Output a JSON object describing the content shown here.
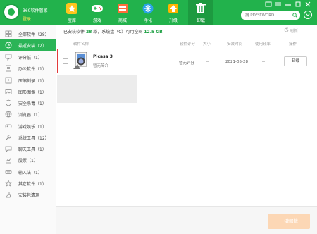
{
  "app": {
    "title": "360软件管家",
    "login": "登录"
  },
  "nav": [
    {
      "label": "宝库",
      "icon": "star-icon"
    },
    {
      "label": "游戏",
      "icon": "gamepad-icon"
    },
    {
      "label": "商城",
      "icon": "store-icon"
    },
    {
      "label": "净化",
      "icon": "purify-icon"
    },
    {
      "label": "升级",
      "icon": "upgrade-icon"
    },
    {
      "label": "卸载",
      "icon": "trash-icon",
      "active": true
    }
  ],
  "search": {
    "placeholder": "搜 PDF转WORD"
  },
  "sidebar": {
    "items": [
      {
        "label": "全部软件（28）",
        "icon": "grid-icon"
      },
      {
        "label": "最近安装（2）",
        "icon": "clock-icon",
        "active": true
      },
      {
        "label": "评分低（1）",
        "icon": "thumb-down-icon"
      },
      {
        "label": "办公软件（1）",
        "icon": "office-icon"
      },
      {
        "label": "压缩刻录（1）",
        "icon": "compress-icon"
      },
      {
        "label": "图形图像（1）",
        "icon": "image-icon"
      },
      {
        "label": "安全杀毒（1）",
        "icon": "shield-icon"
      },
      {
        "label": "浏览器（1）",
        "icon": "browser-icon"
      },
      {
        "label": "游戏娱乐（1）",
        "icon": "game-icon"
      },
      {
        "label": "系统工具（12）",
        "icon": "tools-icon"
      },
      {
        "label": "聊天工具（1）",
        "icon": "chat-icon"
      },
      {
        "label": "股票（1）",
        "icon": "stock-icon"
      },
      {
        "label": "输入法（1）",
        "icon": "keyboard-icon"
      },
      {
        "label": "其它软件（1）",
        "icon": "star-outline-icon"
      },
      {
        "label": "安装包清理",
        "icon": "clean-icon"
      }
    ]
  },
  "summary": {
    "prefix": "已安装软件",
    "count": "28",
    "mid": "款，系统盘（C）可用空间",
    "space": "12.5 GB"
  },
  "refresh_label": "刷新",
  "table": {
    "headers": [
      "软件名称",
      "软件评分",
      "大小",
      "安装时间",
      "使用频率",
      "操作"
    ],
    "rows": [
      {
        "name": "Picasa 3",
        "desc": "暂无简介",
        "rating": "暂无评分",
        "size": "--",
        "date": "2021-05-28",
        "freq": "--",
        "action": "卸载"
      }
    ]
  },
  "bulk_uninstall_label": "一键卸载",
  "colors": {
    "brand": "#22b24c",
    "highlight": "#e23b3b",
    "bulk_button": "#fcd7b5"
  }
}
